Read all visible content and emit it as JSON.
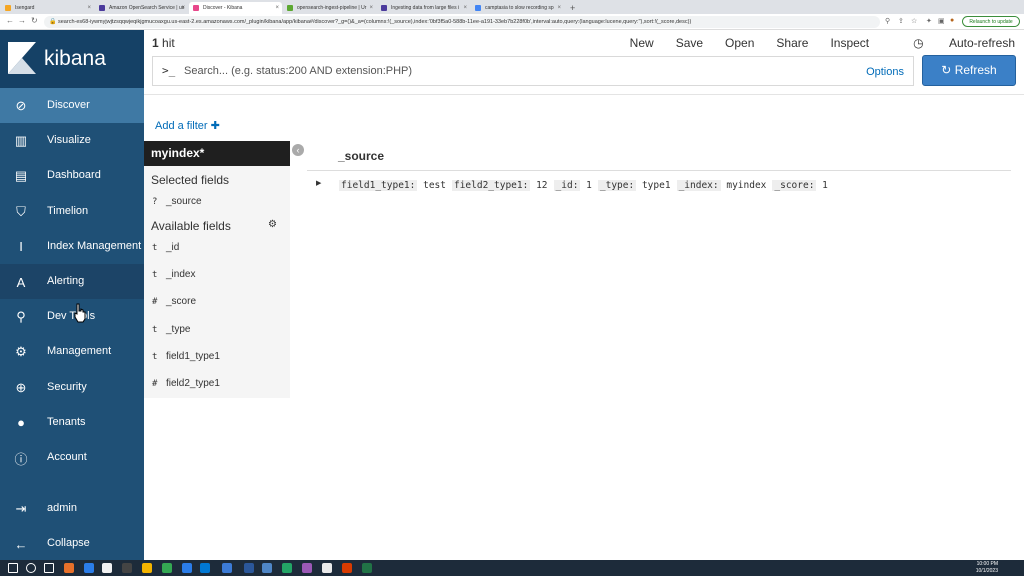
{
  "browser": {
    "tabs": [
      {
        "title": "Isengard",
        "favicon_color": "#f5a623"
      },
      {
        "title": "Amazon OpenSearch Service | us",
        "favicon_color": "#4b3a9c"
      },
      {
        "title": "Discover - Kibana",
        "favicon_color": "#e8478b"
      },
      {
        "title": "opensearch-ingest-pipeline | Ur",
        "favicon_color": "#5ca832"
      },
      {
        "title": "Ingesting data from large files i",
        "favicon_color": "#4b3a9c"
      },
      {
        "title": "camptasia to slow recording sp",
        "favicon_color": "#4285f4"
      }
    ],
    "new_tab": "+",
    "url": "search-es68-iywmyjwjtzsqqwjeqikjgmucoaxgu.us-east-2.es.amazonaws.com/_plugin/kibana/app/kibana#/discover?_g=()&_a=(columns:!(_source),index:'0bf3f5a0-588b-11ee-a191-33eb7b228f0b',interval:auto,query:(language:lucene,query:''),sort:!(_score,desc))",
    "relaunch": "Relaunch to update"
  },
  "sidebar": {
    "brand": "kibana",
    "items": [
      {
        "label": "Discover",
        "icon": "compass-icon",
        "glyph": "⊘"
      },
      {
        "label": "Visualize",
        "icon": "bar-chart-icon",
        "glyph": "▥"
      },
      {
        "label": "Dashboard",
        "icon": "dashboard-icon",
        "glyph": "▤"
      },
      {
        "label": "Timelion",
        "icon": "shield-icon",
        "glyph": "⛉"
      },
      {
        "label": "Index Management",
        "icon": "index-mgmt-icon",
        "glyph": "I"
      },
      {
        "label": "Alerting",
        "icon": "alerting-icon",
        "glyph": "A"
      },
      {
        "label": "Dev Tools",
        "icon": "wrench-icon",
        "glyph": "⚲"
      },
      {
        "label": "Management",
        "icon": "gear-icon",
        "glyph": "⚙"
      },
      {
        "label": "Security",
        "icon": "lock-icon",
        "glyph": "⊕"
      },
      {
        "label": "Tenants",
        "icon": "user-icon",
        "glyph": "●"
      },
      {
        "label": "Account",
        "icon": "info-icon",
        "glyph": "ⓘ"
      }
    ],
    "user": {
      "label": "admin",
      "icon": "logout-icon",
      "glyph": "⇥"
    },
    "collapse": {
      "label": "Collapse",
      "icon": "arrow-left-icon",
      "glyph": "←"
    }
  },
  "topbar": {
    "hits_count": "1",
    "hits_label": "hit",
    "menu": [
      "New",
      "Save",
      "Open",
      "Share",
      "Inspect"
    ],
    "auto_refresh": "Auto-refresh",
    "search_prompt": ">_",
    "search_placeholder": "Search... (e.g. status:200 AND extension:PHP)",
    "options": "Options",
    "refresh": "Refresh",
    "add_filter": "Add a filter"
  },
  "fields": {
    "index": "myindex*",
    "selected_title": "Selected fields",
    "selected": [
      {
        "type": "?",
        "name": "_source"
      }
    ],
    "available_title": "Available fields",
    "available": [
      {
        "type": "t",
        "name": "_id"
      },
      {
        "type": "t",
        "name": "_index"
      },
      {
        "type": "#",
        "name": "_score"
      },
      {
        "type": "t",
        "name": "_type"
      },
      {
        "type": "t",
        "name": "field1_type1"
      },
      {
        "type": "#",
        "name": "field2_type1"
      }
    ]
  },
  "documents": {
    "column": "_source",
    "rows": [
      [
        {
          "key": "field1_type1:",
          "value": "test"
        },
        {
          "key": "field2_type1:",
          "value": "12"
        },
        {
          "key": "_id:",
          "value": "1"
        },
        {
          "key": "_type:",
          "value": "type1"
        },
        {
          "key": "_index:",
          "value": "myindex"
        },
        {
          "key": "_score:",
          "value": "1"
        }
      ]
    ]
  },
  "taskbar": {
    "time": "10:00 PM",
    "date": "10/1/2023"
  }
}
